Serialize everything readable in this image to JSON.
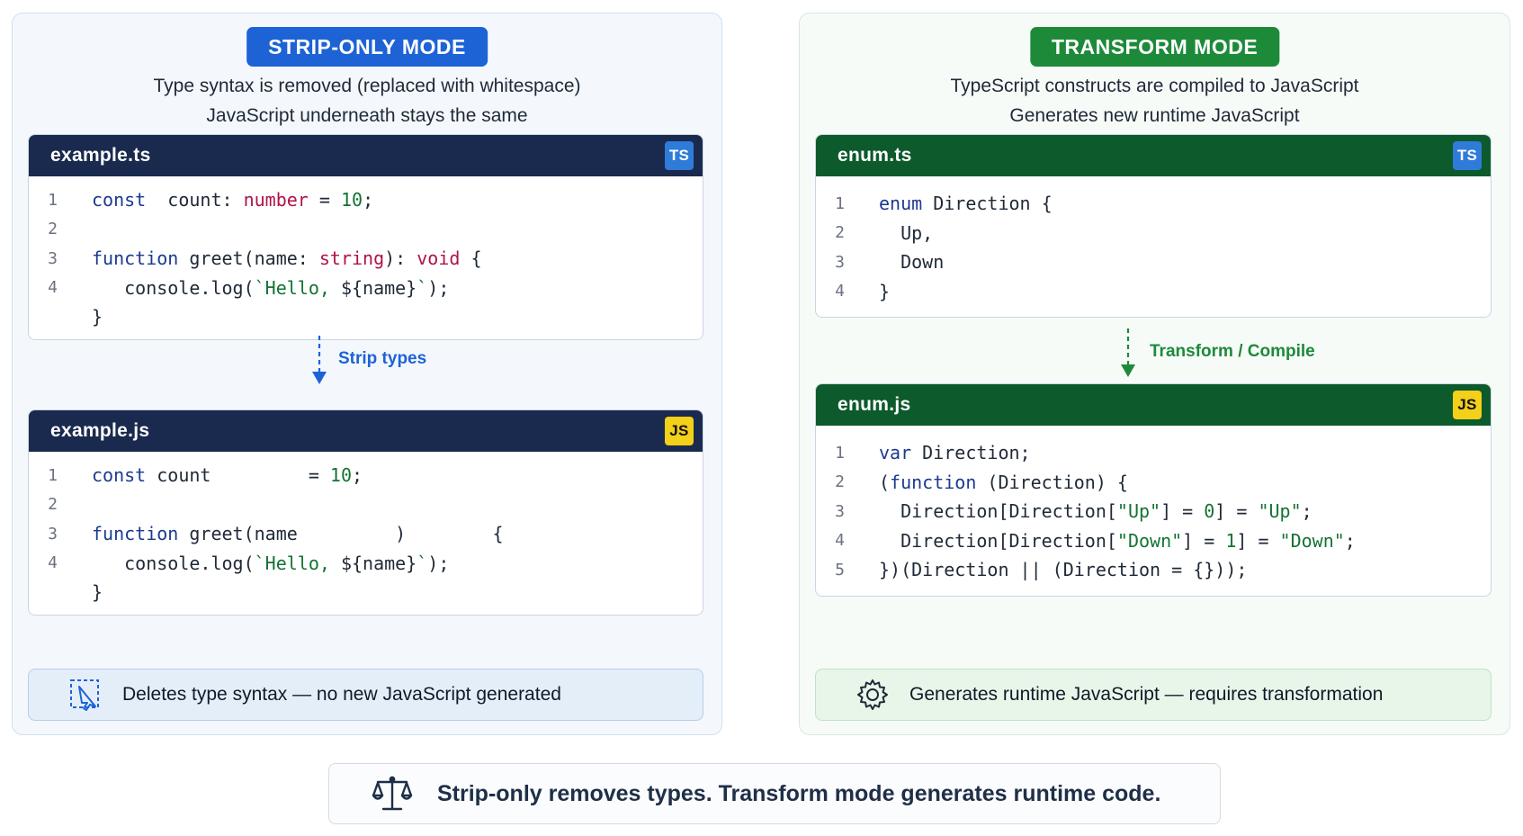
{
  "strip": {
    "badge": "STRIP-ONLY MODE",
    "desc_line1": "Type syntax is removed (replaced with whitespace)",
    "desc_line2": "JavaScript underneath stays the same",
    "source_file": "example.ts",
    "source_lang": "TS",
    "output_file": "example.js",
    "output_lang": "JS",
    "arrow_label": "Strip types",
    "note": "Deletes type syntax — no new JavaScript generated",
    "source_lines": [
      {
        "n": "1",
        "parts": [
          [
            "kw",
            "const"
          ],
          [
            "",
            "  count: "
          ],
          [
            "ty",
            "number"
          ],
          [
            "",
            " = "
          ],
          [
            "num",
            "10"
          ],
          [
            "",
            ";"
          ]
        ]
      },
      {
        "n": "2",
        "parts": []
      },
      {
        "n": "3",
        "parts": [
          [
            "kw",
            "function"
          ],
          [
            "",
            " greet(name: "
          ],
          [
            "ty",
            "string"
          ],
          [
            "",
            "): "
          ],
          [
            "ty",
            "void"
          ],
          [
            "",
            " {"
          ]
        ]
      },
      {
        "n": "4",
        "parts": [
          [
            "",
            "   console.log("
          ],
          [
            "str",
            "`Hello, "
          ],
          [
            "",
            "${name}"
          ],
          [
            "str",
            "`"
          ],
          [
            "",
            ");"
          ]
        ]
      },
      {
        "n": "",
        "parts": [
          [
            "",
            "}"
          ]
        ]
      }
    ],
    "output_lines": [
      {
        "n": "1",
        "parts": [
          [
            "kw",
            "const"
          ],
          [
            "",
            " count         = "
          ],
          [
            "num",
            "10"
          ],
          [
            "",
            ";"
          ]
        ]
      },
      {
        "n": "2",
        "parts": []
      },
      {
        "n": "3",
        "parts": [
          [
            "kw",
            "function"
          ],
          [
            "",
            " greet(name         )        {"
          ]
        ]
      },
      {
        "n": "4",
        "parts": [
          [
            "",
            "   console.log("
          ],
          [
            "str",
            "`Hello, "
          ],
          [
            "",
            "${name}"
          ],
          [
            "str",
            "`"
          ],
          [
            "",
            ");"
          ]
        ]
      },
      {
        "n": "",
        "parts": [
          [
            "",
            "}"
          ]
        ]
      }
    ]
  },
  "transform": {
    "badge": "TRANSFORM MODE",
    "desc_line1": "TypeScript constructs are compiled to JavaScript",
    "desc_line2": "Generates new runtime JavaScript",
    "source_file": "enum.ts",
    "source_lang": "TS",
    "output_file": "enum.js",
    "output_lang": "JS",
    "arrow_label": "Transform / Compile",
    "note": "Generates runtime JavaScript — requires transformation",
    "source_lines": [
      {
        "n": "1",
        "parts": [
          [
            "kw",
            "enum"
          ],
          [
            "",
            " Direction {"
          ]
        ]
      },
      {
        "n": "2",
        "parts": [
          [
            "",
            "  Up,"
          ]
        ]
      },
      {
        "n": "3",
        "parts": [
          [
            "",
            "  Down"
          ]
        ]
      },
      {
        "n": "4",
        "parts": [
          [
            "",
            "}"
          ]
        ]
      }
    ],
    "output_lines": [
      {
        "n": "1",
        "parts": [
          [
            "kw",
            "var"
          ],
          [
            "",
            " Direction;"
          ]
        ]
      },
      {
        "n": "2",
        "parts": [
          [
            "",
            "("
          ],
          [
            "kw",
            "function"
          ],
          [
            "",
            " (Direction) {"
          ]
        ]
      },
      {
        "n": "3",
        "parts": [
          [
            "",
            "  Direction[Direction["
          ],
          [
            "str",
            "\"Up\""
          ],
          [
            "",
            "] = "
          ],
          [
            "num",
            "0"
          ],
          [
            "",
            "] = "
          ],
          [
            "str",
            "\"Up\""
          ],
          [
            "",
            ";"
          ]
        ]
      },
      {
        "n": "4",
        "parts": [
          [
            "",
            "  Direction[Direction["
          ],
          [
            "str",
            "\"Down\""
          ],
          [
            "",
            "] = "
          ],
          [
            "num",
            "1"
          ],
          [
            "",
            "] = "
          ],
          [
            "str",
            "\"Down\""
          ],
          [
            "",
            ";"
          ]
        ]
      },
      {
        "n": "5",
        "parts": [
          [
            "",
            "})(Direction || (Direction = {}));"
          ]
        ]
      }
    ]
  },
  "summary": "Strip-only removes types. Transform mode generates runtime code.",
  "colors": {
    "strip_accent": "#1d63d6",
    "transform_accent": "#1d8a3a",
    "keyword": "#1b3a8f",
    "type": "#b0124a",
    "literal": "#137333"
  },
  "icons": {
    "strip_note": "strip-selection-icon",
    "transform_note": "gear-icon",
    "summary": "balance-scale-icon"
  }
}
